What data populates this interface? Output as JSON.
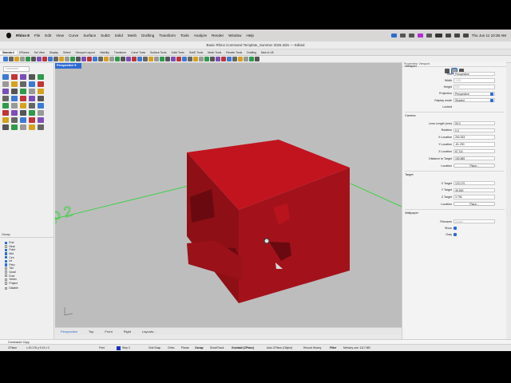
{
  "menubar": {
    "app_name": "Rhino 8",
    "items": [
      "File",
      "Edit",
      "View",
      "Curve",
      "Surface",
      "SubD",
      "Solid",
      "Mesh",
      "Drafting",
      "Transform",
      "Tools",
      "Analyze",
      "Render",
      "Window",
      "Help"
    ],
    "clock": "Thu Jun 11  10:36 AM"
  },
  "window": {
    "title": "Basic Rhino Command Template_Summer 2026.3dm — Edited"
  },
  "toolbar_tabs": [
    "Standard",
    "CPlanes",
    "Set View",
    "Display",
    "Select",
    "Viewport Layout",
    "Visibility",
    "Transform",
    "Curve Tools",
    "Surface Tools",
    "Solid Tools",
    "SubD Tools",
    "Mesh Tools",
    "Render Tools",
    "Drafting",
    "New in V8"
  ],
  "command_input": {
    "placeholder": "Command"
  },
  "osnap": {
    "header": "Osnap",
    "items": [
      {
        "label": "End",
        "checked": true
      },
      {
        "label": "Near",
        "checked": false
      },
      {
        "label": "Point",
        "checked": true
      },
      {
        "label": "Mid",
        "checked": true
      },
      {
        "label": "Cen",
        "checked": true
      },
      {
        "label": "Int",
        "checked": true
      },
      {
        "label": "Perp",
        "checked": true
      },
      {
        "label": "Tan",
        "checked": false
      },
      {
        "label": "Quad",
        "checked": false
      },
      {
        "label": "Knot",
        "checked": false
      },
      {
        "label": "Vertex",
        "checked": false
      },
      {
        "label": "Project",
        "checked": false
      }
    ],
    "disable": "Disable"
  },
  "viewport": {
    "name": "Perspective",
    "label_text": "p 2"
  },
  "viewport_tabs": [
    "Perspective",
    "Top",
    "Front",
    "Right",
    "Layouts..."
  ],
  "properties": {
    "header": "Properties: Viewport",
    "viewport_section": "Viewport",
    "rows": [
      {
        "label": "Title",
        "value": "Perspective",
        "kind": "field"
      },
      {
        "label": "Width",
        "value": "1092",
        "kind": "gray"
      },
      {
        "label": "Height",
        "value": "600",
        "kind": "gray"
      },
      {
        "label": "Projection",
        "value": "Perspective",
        "kind": "dropdown"
      },
      {
        "label": "Display mode",
        "value": "Shaded",
        "kind": "dropdown"
      },
      {
        "label": "Locked",
        "value": "",
        "kind": "none"
      }
    ],
    "camera_section": "Camera",
    "camera_rows": [
      {
        "label": "Lens Length (mm)",
        "value": "50.0"
      },
      {
        "label": "Rotation",
        "value": "0.0"
      },
      {
        "label": "X Location",
        "value": "264.063"
      },
      {
        "label": "Y Location",
        "value": "-81.290"
      },
      {
        "label": "Z Location",
        "value": "67.111"
      },
      {
        "label": "Distance to Target",
        "value": "150.869"
      }
    ],
    "location_button": "Place...",
    "target_section": "Target",
    "target_rows": [
      {
        "label": "X Target",
        "value": "123.170"
      },
      {
        "label": "Y Target",
        "value": "46.663"
      },
      {
        "label": "Z Target",
        "value": "3.766"
      }
    ],
    "wallpaper_section": "Wallpaper",
    "wallpaper_rows": [
      {
        "label": "Filename",
        "value": "(none)"
      },
      {
        "label": "Show",
        "value": ""
      },
      {
        "label": "Gray",
        "value": ""
      }
    ],
    "location_label": "Location"
  },
  "command_history": "Command: Copy",
  "statusbar": {
    "cplane": "CPlane",
    "coords": "x 20.176  y 9.13  z 0",
    "units": "Feet",
    "layer": "Step 2",
    "items": [
      "Grid Snap",
      "Ortho",
      "Planar",
      "Osnap",
      "SmartTrack",
      "Gumball (CPlane)",
      "Auto CPlane (Object)",
      "Record History",
      "Filter"
    ],
    "memory": "Memory use: 1117 MB"
  },
  "colors": {
    "solid_front": "#8e0f16",
    "solid_side": "#a3121b",
    "solid_top": "#c2141f",
    "viewport_bg": "#bdbdbd",
    "accent": "#2d6bd2",
    "grid_green": "#21d62c"
  }
}
